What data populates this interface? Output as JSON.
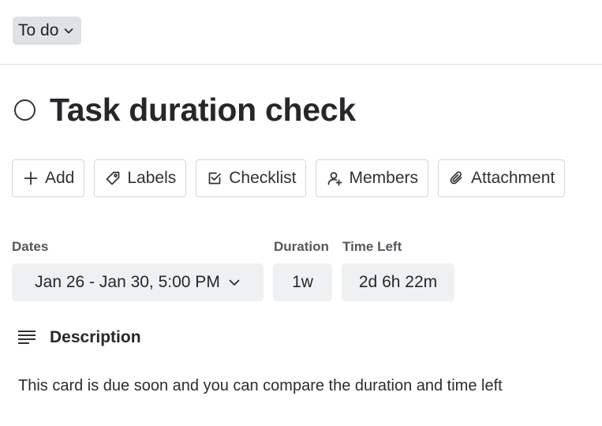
{
  "status": {
    "label": "To do",
    "icon": "chevron-down-icon"
  },
  "card": {
    "title": "Task duration check"
  },
  "actions": [
    {
      "label": "Add",
      "icon": "plus-icon"
    },
    {
      "label": "Labels",
      "icon": "tag-icon"
    },
    {
      "label": "Checklist",
      "icon": "checkbox-icon"
    },
    {
      "label": "Members",
      "icon": "add-person-icon"
    },
    {
      "label": "Attachment",
      "icon": "paperclip-icon"
    }
  ],
  "fields": {
    "dates": {
      "label": "Dates",
      "value": "Jan 26 - Jan 30, 5:00 PM"
    },
    "duration": {
      "label": "Duration",
      "value": "1w"
    },
    "time_left": {
      "label": "Time Left",
      "value": "2d 6h 22m"
    }
  },
  "description": {
    "heading": "Description",
    "text": "This card is due soon and you can compare the duration and time left"
  },
  "colors": {
    "status_bg": "#dfe1e5",
    "field_bg": "#eef0f2",
    "border": "#d5d6d9",
    "text": "#26272b"
  }
}
